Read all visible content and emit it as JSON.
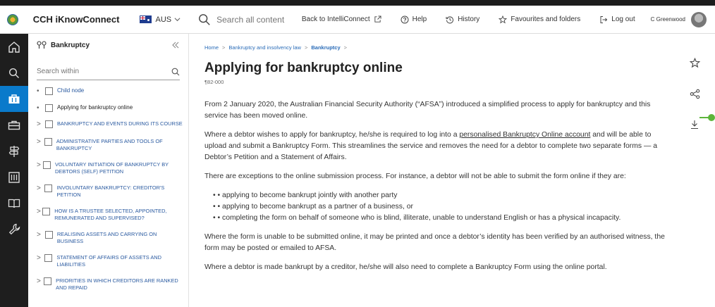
{
  "header": {
    "brand": "CCH iKnowConnect",
    "region": "AUS",
    "search_placeholder": "Search all content",
    "nav": {
      "back": "Back to IntelliConnect",
      "help": "Help",
      "history": "History",
      "favourites": "Favourites and folders",
      "logout": "Log out"
    },
    "user": "C Greenwood"
  },
  "rail": {
    "items": [
      "home-icon",
      "search-icon",
      "briefcase-icon",
      "toolbox-icon",
      "signpost-icon",
      "library-icon",
      "book-icon",
      "wrench-icon"
    ],
    "active_index": 2,
    "active_color": "#0a7acb"
  },
  "sidebar": {
    "title": "Bankruptcy",
    "search_placeholder": "Search within",
    "toc": [
      {
        "marker": "•",
        "label": "Child node"
      },
      {
        "marker": "•",
        "label": "Applying for bankruptcy online"
      },
      {
        "marker": ">",
        "label": "BANKRUPTCY AND EVENTS DURING ITS COURSE"
      },
      {
        "marker": ">",
        "label": "ADMINISTRATIVE PARTIES AND TOOLS OF BANKRUPTCY"
      },
      {
        "marker": ">",
        "label": "VOLUNTARY INITIATION OF BANKRUPTCY BY DEBTORS (SELF) PETITION"
      },
      {
        "marker": ">",
        "label": "INVOLUNTARY BANKRUPTCY: CREDITOR'S PETITION"
      },
      {
        "marker": ">",
        "label": "HOW IS A TRUSTEE SELECTED, APPOINTED, REMUNERATED AND SUPERVISED?"
      },
      {
        "marker": ">",
        "label": "REALISING ASSETS AND CARRYING ON BUSINESS"
      },
      {
        "marker": ">",
        "label": "STATEMENT OF AFFAIRS OF ASSETS AND LIABILITIES"
      },
      {
        "marker": ">",
        "label": "PRIORITIES IN WHICH CREDITORS ARE RANKED AND REPAID"
      }
    ]
  },
  "content": {
    "breadcrumbs": [
      "Home",
      "Bankruptcy and insolvency law",
      "Bankruptcy"
    ],
    "title": "Applying for bankruptcy online",
    "paragraph_no": "¶82-000",
    "p1": "From 2 January 2020, the Australian Financial Security Authority (“AFSA”) introduced a simplified process to apply for bankruptcy and this service has been moved online.",
    "p2_before": "Where a debtor wishes to apply for bankruptcy, he/she is required to log into a ",
    "p2_link": "personalised Bankruptcy Online account",
    "p2_after": " and will be able to upload and submit a Bankruptcy Form. This streamlines the service and removes the need for a debtor to complete two separate forms — a Debtor’s Petition and a Statement of Affairs.",
    "p3": "There are exceptions to the online submission process. For instance, a debtor will not be able to submit the form online if they are:",
    "bullets": [
      "• applying to become bankrupt jointly with another party",
      "• applying to become bankrupt as a partner of a business, or",
      "• completing the form on behalf of someone who is blind, illiterate, unable to understand English or has a physical incapacity."
    ],
    "p4": "Where the form is unable to be submitted online, it may be printed and once a debtor’s identity has been verified by an authorised witness, the form may be posted or emailed to AFSA.",
    "p5": "Where a debtor is made bankrupt by a creditor, he/she will also need to complete a Bankruptcy Form using the online portal."
  }
}
